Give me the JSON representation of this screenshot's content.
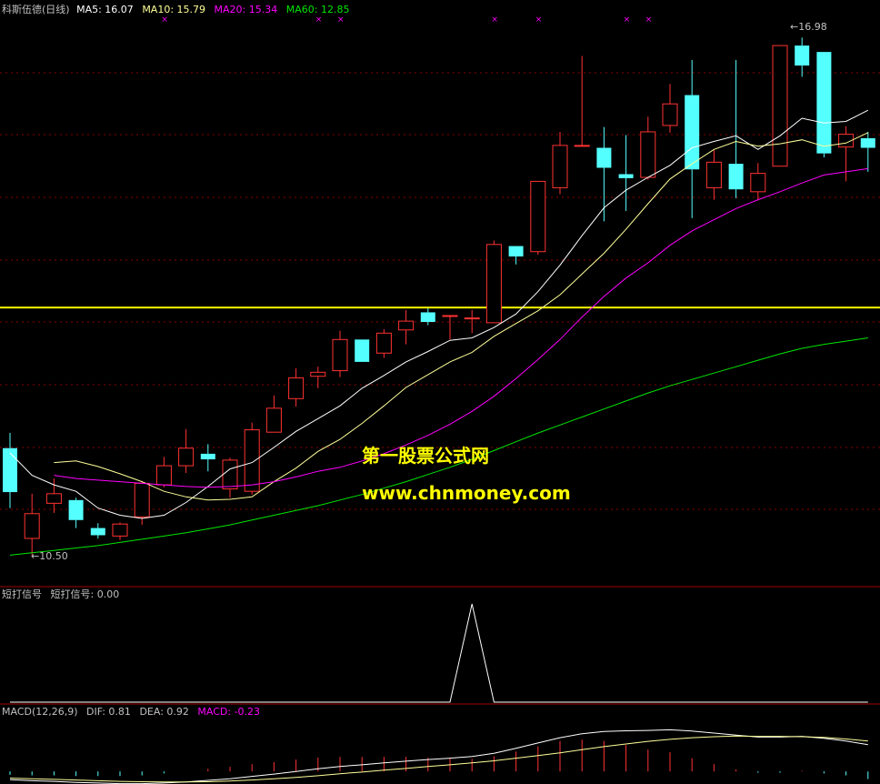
{
  "colors": {
    "up": "#ff3232",
    "down": "#54ffff",
    "ma5": "#ffffff",
    "ma10": "#ffff99",
    "ma20": "#ff00ff",
    "ma60": "#00e600",
    "text": "#c0c0c0",
    "divider": "#a00000",
    "grid": "#8b0000",
    "support": "#ffff00",
    "watermark": "#ffff00"
  },
  "header": {
    "main_prefix": "科斯伍德(日线)",
    "ma5": "MA5: 16.07",
    "ma10": "MA10: 15.79",
    "ma20": "MA20: 15.34",
    "ma60": "MA60: 12.85"
  },
  "markers": {
    "high": "16.98",
    "low": "10.50"
  },
  "signal_panel": {
    "title": "短打信号",
    "value_label": "短打信号: 0.00"
  },
  "macd_panel": {
    "title": "MACD(12,26,9)",
    "dif": "DIF: 0.81",
    "dea": "DEA: 0.92",
    "macd": "MACD: -0.23"
  },
  "watermark": {
    "line1": "第一股票公式网",
    "line2": "www.chnmoney.com"
  },
  "chart_data": [
    {
      "type": "candlestick",
      "ylim": [
        10.3,
        17.2
      ],
      "support_level": 13.6,
      "grid": true,
      "candles": [
        {
          "o": 11.84,
          "h": 12.03,
          "l": 11.09,
          "c": 11.29
        },
        {
          "o": 10.71,
          "h": 11.27,
          "l": 10.5,
          "c": 11.02
        },
        {
          "o": 11.15,
          "h": 11.46,
          "l": 11.03,
          "c": 11.27
        },
        {
          "o": 11.19,
          "h": 11.22,
          "l": 10.84,
          "c": 10.94
        },
        {
          "o": 10.84,
          "h": 10.9,
          "l": 10.71,
          "c": 10.75
        },
        {
          "o": 10.74,
          "h": 10.91,
          "l": 10.69,
          "c": 10.89
        },
        {
          "o": 10.98,
          "h": 11.43,
          "l": 10.88,
          "c": 11.4
        },
        {
          "o": 11.38,
          "h": 11.73,
          "l": 11.35,
          "c": 11.62
        },
        {
          "o": 11.62,
          "h": 12.08,
          "l": 11.53,
          "c": 11.84
        },
        {
          "o": 11.77,
          "h": 11.89,
          "l": 11.55,
          "c": 11.7
        },
        {
          "o": 11.33,
          "h": 11.72,
          "l": 11.22,
          "c": 11.69
        },
        {
          "o": 11.3,
          "h": 12.16,
          "l": 11.26,
          "c": 12.07
        },
        {
          "o": 12.04,
          "h": 12.5,
          "l": 12.04,
          "c": 12.34
        },
        {
          "o": 12.46,
          "h": 12.84,
          "l": 12.36,
          "c": 12.72
        },
        {
          "o": 12.74,
          "h": 12.86,
          "l": 12.59,
          "c": 12.79
        },
        {
          "o": 12.81,
          "h": 13.31,
          "l": 12.73,
          "c": 13.2
        },
        {
          "o": 13.2,
          "h": 13.2,
          "l": 12.92,
          "c": 12.92
        },
        {
          "o": 13.03,
          "h": 13.33,
          "l": 12.97,
          "c": 13.28
        },
        {
          "o": 13.32,
          "h": 13.57,
          "l": 13.14,
          "c": 13.43
        },
        {
          "o": 13.54,
          "h": 13.59,
          "l": 13.38,
          "c": 13.42
        },
        {
          "o": 13.5,
          "h": 13.5,
          "l": 13.2,
          "c": 13.5
        },
        {
          "o": 13.47,
          "h": 13.57,
          "l": 13.28,
          "c": 13.47
        },
        {
          "o": 13.41,
          "h": 14.44,
          "l": 13.41,
          "c": 14.39
        },
        {
          "o": 14.37,
          "h": 14.37,
          "l": 14.14,
          "c": 14.24
        },
        {
          "o": 14.3,
          "h": 15.18,
          "l": 14.26,
          "c": 15.18
        },
        {
          "o": 15.1,
          "h": 15.8,
          "l": 15.02,
          "c": 15.63
        },
        {
          "o": 15.63,
          "h": 16.75,
          "l": 15.63,
          "c": 15.63
        },
        {
          "o": 15.6,
          "h": 15.86,
          "l": 14.68,
          "c": 15.35
        },
        {
          "o": 15.27,
          "h": 15.76,
          "l": 14.81,
          "c": 15.22
        },
        {
          "o": 15.23,
          "h": 15.99,
          "l": 15.2,
          "c": 15.8
        },
        {
          "o": 15.88,
          "h": 16.4,
          "l": 15.79,
          "c": 16.15
        },
        {
          "o": 16.26,
          "h": 16.7,
          "l": 14.72,
          "c": 15.33
        },
        {
          "o": 15.1,
          "h": 15.57,
          "l": 14.95,
          "c": 15.42
        },
        {
          "o": 15.4,
          "h": 16.7,
          "l": 14.97,
          "c": 15.08
        },
        {
          "o": 15.05,
          "h": 15.41,
          "l": 14.94,
          "c": 15.28
        },
        {
          "o": 15.37,
          "h": 16.88,
          "l": 15.37,
          "c": 16.88
        },
        {
          "o": 16.88,
          "h": 16.98,
          "l": 16.49,
          "c": 16.63
        },
        {
          "o": 16.8,
          "h": 16.8,
          "l": 15.48,
          "c": 15.53
        },
        {
          "o": 15.61,
          "h": 15.87,
          "l": 15.18,
          "c": 15.77
        },
        {
          "o": 15.72,
          "h": 15.8,
          "l": 15.3,
          "c": 15.6
        }
      ],
      "ma5": [
        11.78,
        11.5,
        11.38,
        11.3,
        11.09,
        11.0,
        10.96,
        11.0,
        11.16,
        11.36,
        11.58,
        11.66,
        11.85,
        12.05,
        12.21,
        12.37,
        12.59,
        12.75,
        12.92,
        13.05,
        13.19,
        13.22,
        13.35,
        13.52,
        13.8,
        14.13,
        14.5,
        14.85,
        15.07,
        15.23,
        15.38,
        15.6,
        15.68,
        15.75,
        15.58,
        15.75,
        15.97,
        15.91,
        15.93,
        16.07
      ],
      "ma10": [
        null,
        null,
        11.66,
        11.68,
        11.61,
        11.52,
        11.42,
        11.3,
        11.23,
        11.19,
        11.2,
        11.23,
        11.42,
        11.59,
        11.8,
        11.95,
        12.15,
        12.37,
        12.6,
        12.76,
        12.92,
        13.04,
        13.24,
        13.4,
        13.56,
        13.76,
        14.02,
        14.28,
        14.58,
        14.9,
        15.21,
        15.4,
        15.58,
        15.68,
        15.62,
        15.65,
        15.7,
        15.62,
        15.66,
        15.79
      ],
      "ma20": [
        null,
        null,
        11.5,
        11.46,
        11.44,
        11.42,
        11.4,
        11.38,
        11.36,
        11.35,
        11.36,
        11.38,
        11.42,
        11.48,
        11.55,
        11.6,
        11.68,
        11.77,
        11.88,
        12.0,
        12.14,
        12.3,
        12.49,
        12.71,
        12.95,
        13.2,
        13.48,
        13.74,
        13.97,
        14.16,
        14.38,
        14.56,
        14.7,
        14.84,
        14.95,
        15.05,
        15.16,
        15.26,
        15.3,
        15.34
      ],
      "ma60": [
        10.5,
        10.53,
        10.56,
        10.59,
        10.62,
        10.66,
        10.7,
        10.74,
        10.78,
        10.83,
        10.88,
        10.94,
        11.0,
        11.06,
        11.12,
        11.19,
        11.26,
        11.34,
        11.42,
        11.51,
        11.6,
        11.7,
        11.81,
        11.92,
        12.03,
        12.13,
        12.23,
        12.33,
        12.43,
        12.53,
        12.62,
        12.7,
        12.78,
        12.86,
        12.94,
        13.02,
        13.09,
        13.14,
        13.18,
        13.22
      ]
    },
    {
      "type": "line",
      "series": [
        {
          "values": [
            0,
            0,
            0,
            0,
            0,
            0,
            0,
            0,
            0,
            0,
            0,
            0,
            0,
            0,
            0,
            0,
            0,
            0,
            0,
            0,
            0,
            1,
            0,
            0,
            0,
            0,
            0,
            0,
            0,
            0,
            0,
            0,
            0,
            0,
            0,
            0,
            0,
            0,
            0,
            0
          ]
        }
      ],
      "ylim": [
        0,
        1
      ]
    },
    {
      "type": "bar",
      "ylim": [
        -0.6,
        1.6
      ],
      "dif": [
        -0.25,
        -0.28,
        -0.3,
        -0.33,
        -0.35,
        -0.37,
        -0.37,
        -0.35,
        -0.32,
        -0.27,
        -0.22,
        -0.15,
        -0.08,
        0.0,
        0.08,
        0.15,
        0.2,
        0.26,
        0.31,
        0.36,
        0.4,
        0.45,
        0.55,
        0.7,
        0.86,
        1.02,
        1.14,
        1.21,
        1.23,
        1.24,
        1.26,
        1.22,
        1.16,
        1.1,
        1.04,
        1.04,
        1.06,
        1.0,
        0.92,
        0.81
      ],
      "dea": [
        -0.2,
        -0.22,
        -0.24,
        -0.26,
        -0.28,
        -0.3,
        -0.31,
        -0.32,
        -0.32,
        -0.31,
        -0.29,
        -0.26,
        -0.22,
        -0.18,
        -0.13,
        -0.07,
        -0.02,
        0.04,
        0.09,
        0.15,
        0.2,
        0.26,
        0.32,
        0.4,
        0.48,
        0.56,
        0.66,
        0.75,
        0.83,
        0.91,
        0.97,
        1.02,
        1.05,
        1.07,
        1.06,
        1.06,
        1.05,
        1.03,
        0.98,
        0.92
      ],
      "macd": [
        -0.1,
        -0.12,
        -0.12,
        -0.14,
        -0.14,
        -0.14,
        -0.12,
        -0.06,
        0.0,
        0.08,
        0.14,
        0.22,
        0.28,
        0.36,
        0.42,
        0.44,
        0.44,
        0.44,
        0.44,
        0.42,
        0.4,
        0.38,
        0.46,
        0.6,
        0.76,
        0.92,
        0.96,
        0.92,
        0.8,
        0.66,
        0.58,
        0.4,
        0.22,
        0.06,
        -0.04,
        -0.04,
        0.02,
        -0.06,
        -0.12,
        -0.23
      ]
    }
  ]
}
